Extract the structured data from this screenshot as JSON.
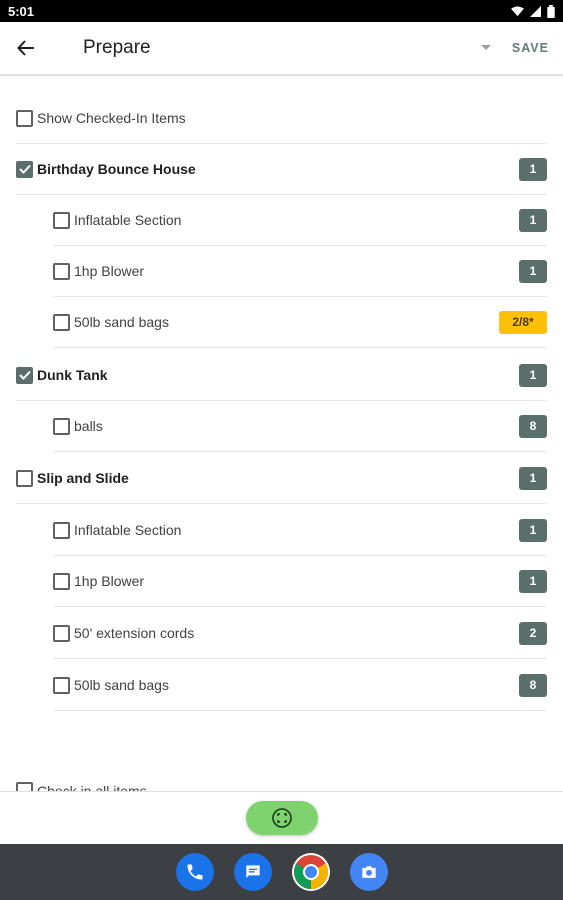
{
  "status": {
    "time": "5:01"
  },
  "header": {
    "title": "Prepare",
    "save_label": "SAVE"
  },
  "show_checked_in": {
    "label": "Show Checked-In Items",
    "checked": false
  },
  "items": [
    {
      "label": "Birthday Bounce House",
      "level": 0,
      "checked": true,
      "count": "1",
      "badge_style": "normal"
    },
    {
      "label": "Inflatable Section",
      "level": 1,
      "checked": false,
      "count": "1",
      "badge_style": "normal"
    },
    {
      "label": "1hp Blower",
      "level": 1,
      "checked": false,
      "count": "1",
      "badge_style": "normal"
    },
    {
      "label": "50lb sand bags",
      "level": 1,
      "checked": false,
      "count": "2/8*",
      "badge_style": "warning"
    },
    {
      "label": "Dunk Tank",
      "level": 0,
      "checked": true,
      "count": "1",
      "badge_style": "normal"
    },
    {
      "label": "balls",
      "level": 1,
      "checked": false,
      "count": "8",
      "badge_style": "normal"
    },
    {
      "label": "Slip and Slide",
      "level": 0,
      "checked": false,
      "count": "1",
      "badge_style": "normal"
    },
    {
      "label": "Inflatable Section",
      "level": 1,
      "checked": false,
      "count": "1",
      "badge_style": "normal"
    },
    {
      "label": "1hp Blower",
      "level": 1,
      "checked": false,
      "count": "1",
      "badge_style": "normal"
    },
    {
      "label": "50' extension cords",
      "level": 1,
      "checked": false,
      "count": "2",
      "badge_style": "normal"
    },
    {
      "label": "50lb sand bags",
      "level": 1,
      "checked": false,
      "count": "8",
      "badge_style": "normal"
    }
  ],
  "check_all": {
    "label": "Check in all items",
    "checked": false
  },
  "colors": {
    "accent": "#5b6f6a",
    "warning": "#ffc107",
    "fab": "#7ed36f",
    "nav_bar": "#3c3f44"
  },
  "dock": [
    {
      "name": "phone-icon",
      "color": "#1a73e8"
    },
    {
      "name": "messages-icon",
      "color": "#1a73e8"
    },
    {
      "name": "chrome-icon",
      "color": "#ffffff"
    },
    {
      "name": "camera-icon",
      "color": "#4285f4"
    }
  ]
}
